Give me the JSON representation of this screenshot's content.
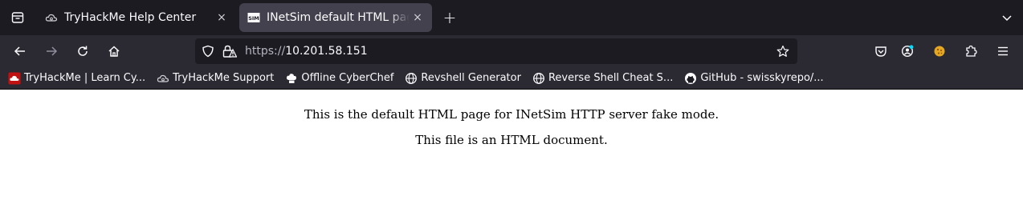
{
  "tabs": [
    {
      "title": "TryHackMe Help Center",
      "close": "×",
      "active": false
    },
    {
      "title": "INetSim default HTML page",
      "close": "×",
      "active": true,
      "favicon_text": "SIM"
    }
  ],
  "new_tab": "+",
  "urlbar": {
    "scheme": "https://",
    "host": "10.201.58.151"
  },
  "bookmarks": [
    {
      "label": "TryHackMe | Learn Cy...",
      "icon": "tryhackme-icon"
    },
    {
      "label": "TryHackMe Support",
      "icon": "cloud-icon"
    },
    {
      "label": "Offline CyberChef",
      "icon": "chef-hat-icon"
    },
    {
      "label": "Revshell Generator",
      "icon": "globe-icon"
    },
    {
      "label": "Reverse Shell Cheat S...",
      "icon": "globe-icon"
    },
    {
      "label": "GitHub - swisskyrepo/...",
      "icon": "github-icon"
    }
  ],
  "page": {
    "line1": "This is the default HTML page for INetSim HTTP server fake mode.",
    "line2": "This file is an HTML document."
  },
  "colors": {
    "chrome_dark": "#1c1b22",
    "toolbar": "#2b2a33",
    "active_tab": "#42414d",
    "accent_blue": "#0df"
  }
}
